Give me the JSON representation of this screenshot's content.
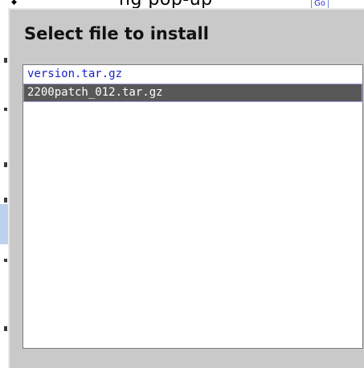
{
  "background": {
    "clipped_text": "ng pop-up",
    "link_text": "Go",
    "arrow_glyph": "◆"
  },
  "dialog": {
    "title": "Select file to install",
    "files": [
      {
        "name": "version.tar.gz",
        "selected": false
      },
      {
        "name": "2200patch_012.tar.gz",
        "selected": true
      }
    ]
  },
  "colors": {
    "dialog_background": "#c9c9c9",
    "list_background": "#ffffff",
    "file_text": "#1a22c8",
    "selected_row_background": "#585858",
    "selected_row_text": "#ffffff"
  }
}
